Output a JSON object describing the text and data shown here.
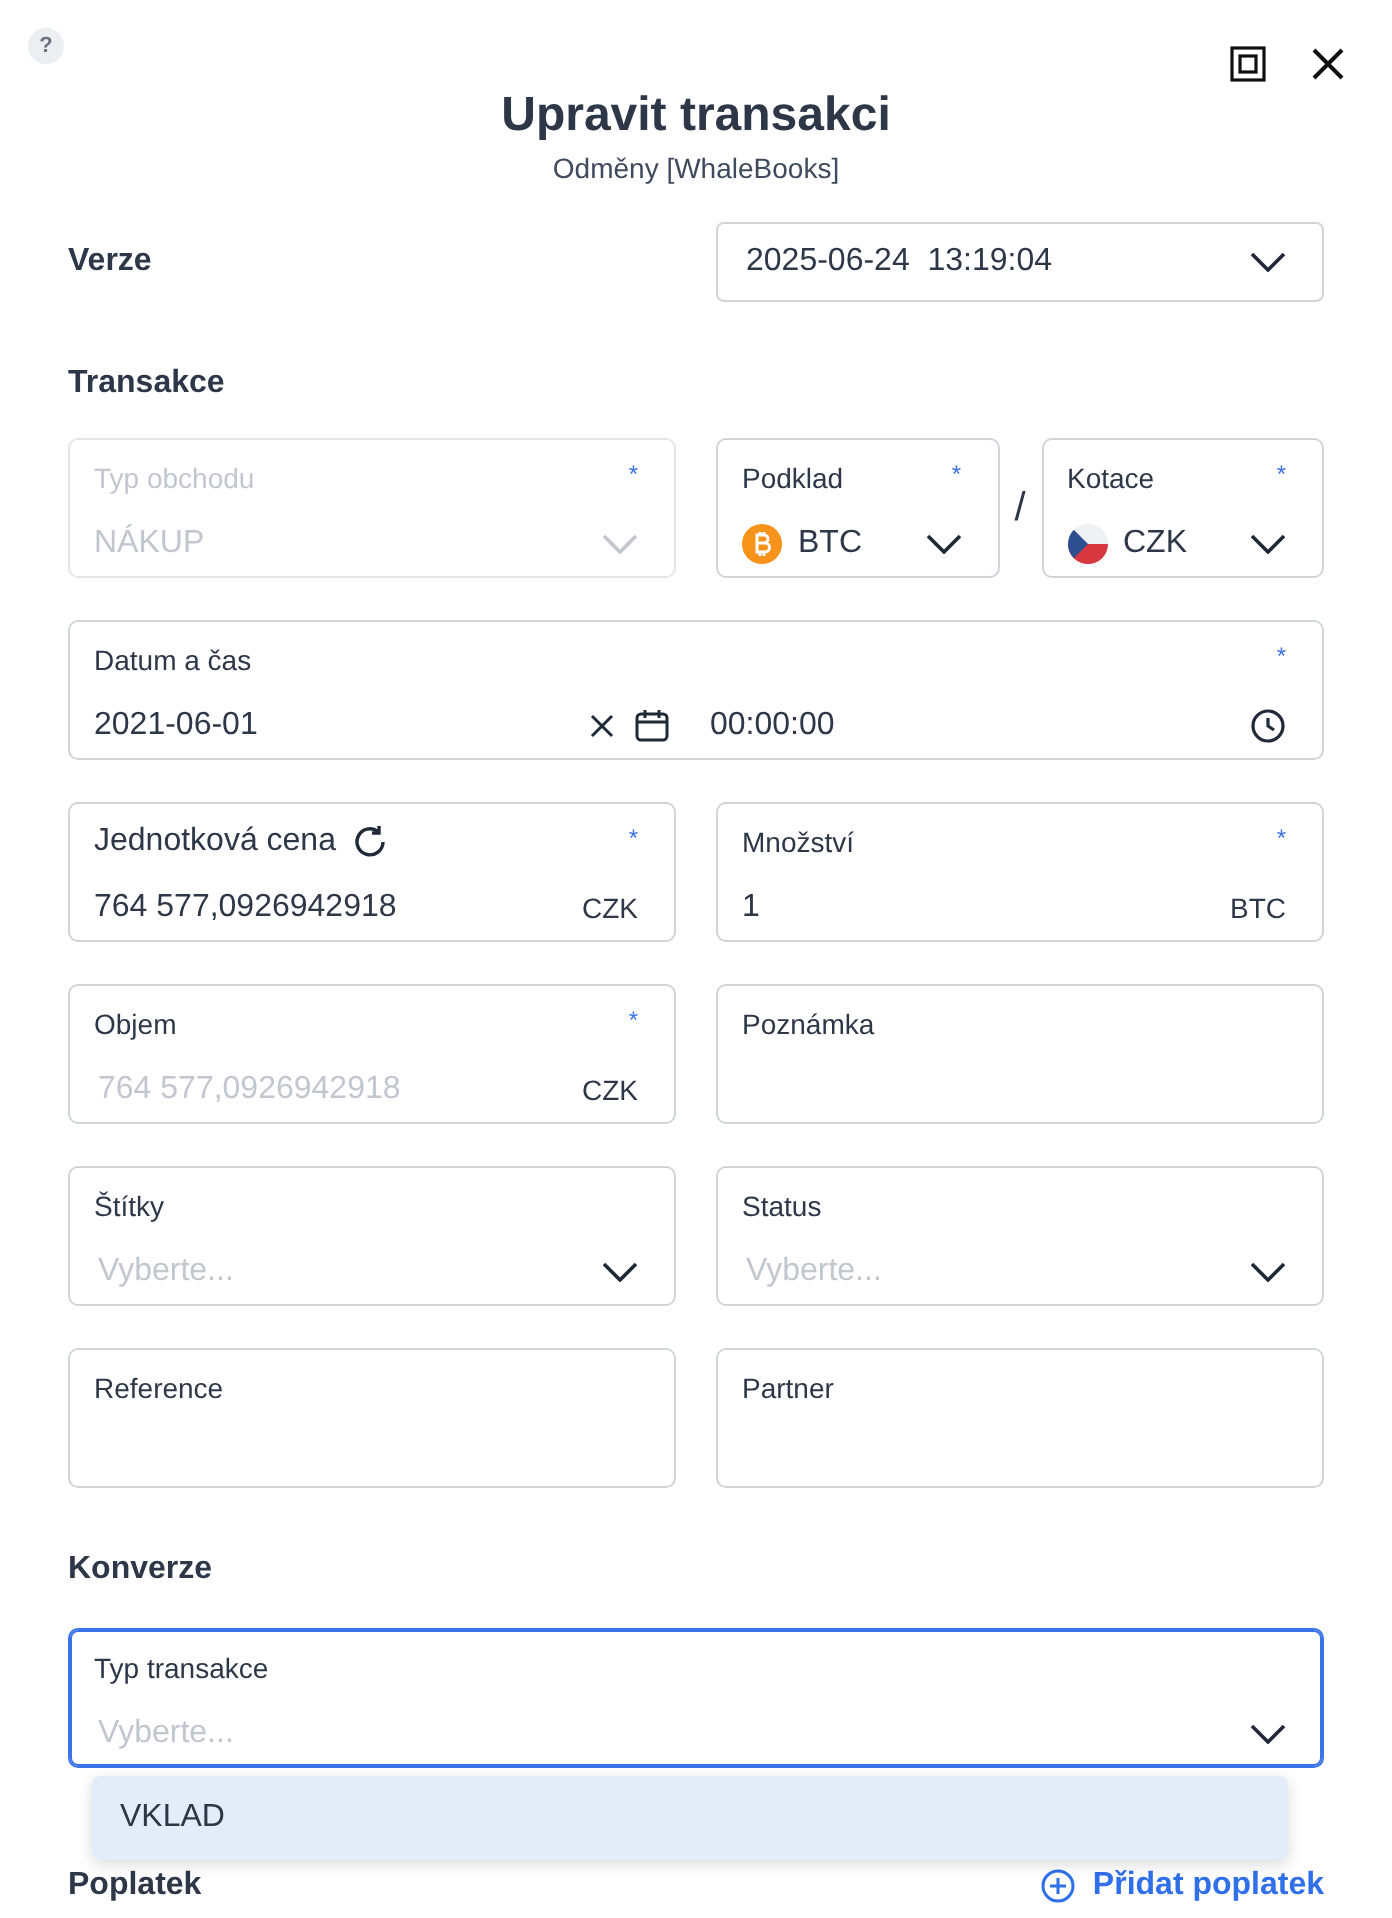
{
  "dialog": {
    "help_icon": "?",
    "title": "Upravit transakci",
    "subtitle": "Odměny [WhaleBooks]"
  },
  "version": {
    "label": "Verze",
    "value": "2025-06-24  13:19:04"
  },
  "transaction": {
    "heading": "Transakce",
    "trade_type": {
      "label": "Typ obchodu",
      "required_mark": "*",
      "value": "NÁKUP",
      "disabled": true
    },
    "base": {
      "label": "Podklad",
      "required_mark": "*",
      "value": "BTC",
      "disabled": false
    },
    "pair_separator": "/",
    "quote": {
      "label": "Kotace",
      "required_mark": "*",
      "value": "CZK",
      "disabled": false
    },
    "date_time": {
      "label": "Datum a čas",
      "required_mark": "*",
      "date": "2021-06-01",
      "time": "00:00:00"
    },
    "unit_price": {
      "label": "Jednotková cena",
      "required_mark": "*",
      "value": "764 577,0926942918",
      "unit": "CZK"
    },
    "quantity": {
      "label": "Množství",
      "required_mark": "*",
      "value": "1",
      "unit": "BTC"
    },
    "volume": {
      "label": "Objem",
      "required_mark": "*",
      "placeholder": "764 577,0926942918",
      "unit": "CZK"
    },
    "note": {
      "label": "Poznámka"
    },
    "tags": {
      "label": "Štítky",
      "placeholder": "Vyberte..."
    },
    "status": {
      "label": "Status",
      "placeholder": "Vyberte..."
    },
    "reference": {
      "label": "Reference"
    },
    "partner": {
      "label": "Partner"
    }
  },
  "conversion": {
    "heading": "Konverze",
    "transaction_type": {
      "label": "Typ transakce",
      "placeholder": "Vyberte...",
      "focused": true
    },
    "menu": [
      {
        "label": "VKLAD",
        "highlighted": true
      }
    ]
  },
  "fees": {
    "heading": "Poplatek",
    "add_button": "Přidat poplatek"
  }
}
